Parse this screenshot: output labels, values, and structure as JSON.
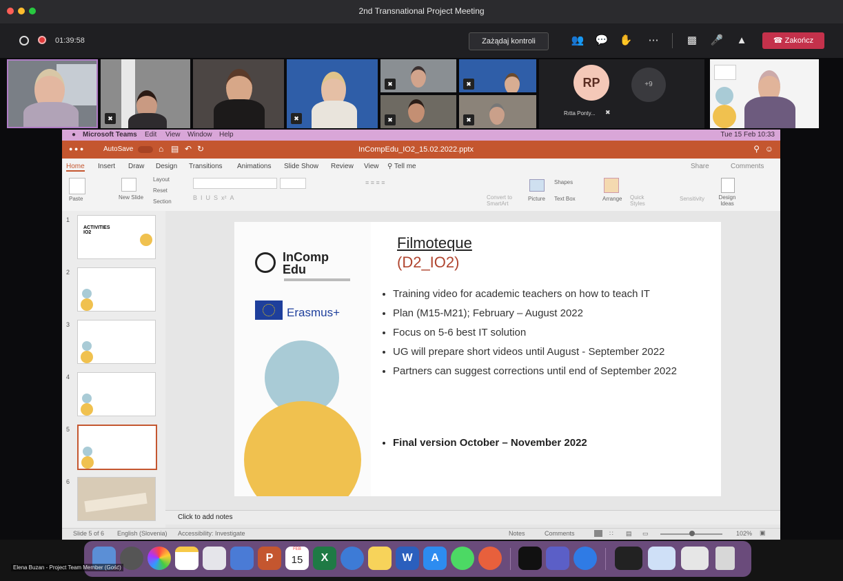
{
  "window": {
    "title": "2nd Transnational Project Meeting"
  },
  "toolbar": {
    "timer": "01:39:58",
    "request_control": "Zażądaj kontroli",
    "end_call": "Zakończ"
  },
  "participants": {
    "avatar_initials": "RP",
    "avatar_name": "Rıtta Ponty...",
    "overflow_count": "+9"
  },
  "mac_menu": {
    "items": [
      "Microsoft Teams",
      "Edit",
      "View",
      "Window",
      "Help"
    ],
    "clock": "Tue 15 Feb 10:33"
  },
  "ppt": {
    "autosave": "AutoSave",
    "file_name": "InCompEdu_IO2_15.02.2022.pptx",
    "tabs": [
      "Home",
      "Insert",
      "Draw",
      "Design",
      "Transitions",
      "Animations",
      "Slide Show",
      "Review",
      "View"
    ],
    "tell_me": "Tell me",
    "share": "Share",
    "comments": "Comments",
    "ribbon": {
      "paste": "Paste",
      "new_slide": "New Slide",
      "layout": "Layout",
      "reset": "Reset",
      "section": "Section",
      "convert": "Convert to SmartArt",
      "picture": "Picture",
      "shapes": "Shapes",
      "text_box": "Text Box",
      "arrange": "Arrange",
      "quick_styles": "Quick Styles",
      "sensitivity": "Sensitivity",
      "design_ideas": "Design Ideas"
    },
    "thumbnails": [
      {
        "num": "1",
        "text": "ACTIVITIES IO2"
      },
      {
        "num": "2",
        "text": ""
      },
      {
        "num": "3",
        "text": ""
      },
      {
        "num": "4",
        "text": ""
      },
      {
        "num": "5",
        "text": ""
      },
      {
        "num": "6",
        "text": ""
      }
    ],
    "slide": {
      "logo_line1": "InComp",
      "logo_line2": "Edu",
      "erasmus": "Erasmus+",
      "title": "Filmoteque",
      "subtitle": "(D2_IO2)",
      "bullets": [
        "Training video for academic teachers on how to teach IT",
        "Plan (M15-M21); February – August 2022",
        "Focus on 5-6 best IT solution",
        "UG will prepare short videos until August - September 2022",
        "Partners can suggest corrections until end of September 2022"
      ],
      "final_bullet": "Final version October – November 2022"
    },
    "notes_placeholder": "Click to add notes",
    "status": {
      "slide_count": "Slide 5 of 6",
      "language": "English (Slovenia)",
      "accessibility": "Accessibility: Investigate",
      "notes": "Notes",
      "comments": "Comments",
      "zoom": "102%"
    }
  },
  "dock": {
    "calendar_month": "FEB",
    "calendar_day": "15"
  },
  "speaker_caption": "Elena Buzan - Project Team Member (Gość)",
  "colors": {
    "ppt_orange": "#c4562f",
    "teams_red": "#c4314b",
    "slide_blue": "#a9cbd6",
    "slide_yellow": "#f0c14f",
    "subtitle_red": "#b0452f"
  }
}
